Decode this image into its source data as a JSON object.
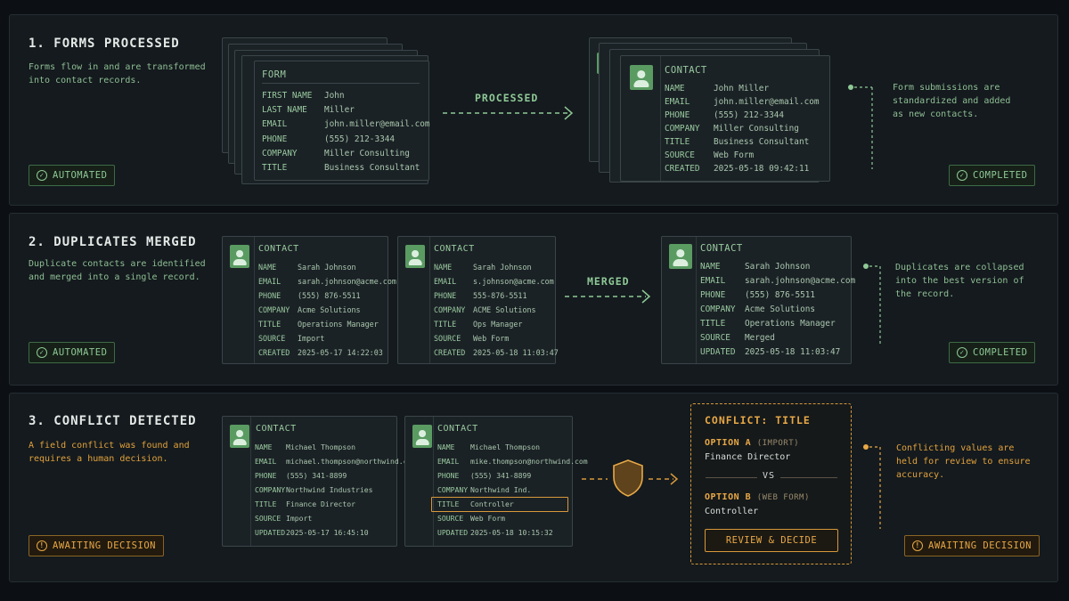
{
  "colors": {
    "background": "#0c1014",
    "panel": "#141a1e",
    "accent_green": "#8fc996",
    "accent_amber": "#e8a846"
  },
  "sections": [
    {
      "title": "1. FORMS PROCESSED",
      "description": "Forms flow in and are transformed into contact records.",
      "left_badge": {
        "label": "AUTOMATED",
        "icon": "check-circle-icon"
      },
      "right_badge": {
        "label": "COMPLETED",
        "icon": "check-circle-icon"
      },
      "arrow_label": "PROCESSED",
      "note": "Form submissions are standardized and added as new contacts.",
      "form": {
        "title": "FORM",
        "fields": [
          {
            "k": "FIRST NAME",
            "v": "John"
          },
          {
            "k": "LAST NAME",
            "v": "Miller"
          },
          {
            "k": "EMAIL",
            "v": "john.miller@email.com"
          },
          {
            "k": "PHONE",
            "v": "(555) 212-3344"
          },
          {
            "k": "COMPANY",
            "v": "Miller Consulting"
          },
          {
            "k": "TITLE",
            "v": "Business Consultant"
          }
        ]
      },
      "contact": {
        "title": "CONTACT",
        "fields": [
          {
            "k": "NAME",
            "v": "John Miller"
          },
          {
            "k": "EMAIL",
            "v": "john.miller@email.com"
          },
          {
            "k": "PHONE",
            "v": "(555) 212-3344"
          },
          {
            "k": "COMPANY",
            "v": "Miller Consulting"
          },
          {
            "k": "TITLE",
            "v": "Business Consultant"
          },
          {
            "k": "SOURCE",
            "v": "Web Form"
          },
          {
            "k": "CREATED",
            "v": "2025-05-18 09:42:11"
          }
        ]
      }
    },
    {
      "title": "2. DUPLICATES MERGED",
      "description": "Duplicate contacts are identified and merged into a single record.",
      "left_badge": {
        "label": "AUTOMATED",
        "icon": "check-circle-icon"
      },
      "right_badge": {
        "label": "COMPLETED",
        "icon": "check-circle-icon"
      },
      "arrow_label": "MERGED",
      "note": "Duplicates are collapsed into the best version of the record.",
      "contact_a": {
        "title": "CONTACT",
        "fields": [
          {
            "k": "NAME",
            "v": "Sarah Johnson"
          },
          {
            "k": "EMAIL",
            "v": "sarah.johnson@acme.com"
          },
          {
            "k": "PHONE",
            "v": "(555) 876-5511"
          },
          {
            "k": "COMPANY",
            "v": "Acme Solutions"
          },
          {
            "k": "TITLE",
            "v": "Operations Manager"
          },
          {
            "k": "SOURCE",
            "v": "Import"
          },
          {
            "k": "CREATED",
            "v": "2025-05-17 14:22:03"
          }
        ]
      },
      "contact_b": {
        "title": "CONTACT",
        "fields": [
          {
            "k": "NAME",
            "v": "Sarah Johnson"
          },
          {
            "k": "EMAIL",
            "v": "s.johnson@acme.com"
          },
          {
            "k": "PHONE",
            "v": "555-876-5511"
          },
          {
            "k": "COMPANY",
            "v": "ACME Solutions"
          },
          {
            "k": "TITLE",
            "v": "Ops Manager"
          },
          {
            "k": "SOURCE",
            "v": "Web Form"
          },
          {
            "k": "CREATED",
            "v": "2025-05-18 11:03:47"
          }
        ]
      },
      "contact_merged": {
        "title": "CONTACT",
        "fields": [
          {
            "k": "NAME",
            "v": "Sarah Johnson"
          },
          {
            "k": "EMAIL",
            "v": "sarah.johnson@acme.com"
          },
          {
            "k": "PHONE",
            "v": "(555) 876-5511"
          },
          {
            "k": "COMPANY",
            "v": "Acme Solutions"
          },
          {
            "k": "TITLE",
            "v": "Operations Manager"
          },
          {
            "k": "SOURCE",
            "v": "Merged"
          },
          {
            "k": "UPDATED",
            "v": "2025-05-18 11:03:47"
          }
        ]
      }
    },
    {
      "title": "3. CONFLICT DETECTED",
      "description": "A field conflict was found and requires a human decision.",
      "left_badge": {
        "label": "AWAITING DECISION",
        "icon": "alert-circle-icon"
      },
      "right_badge": {
        "label": "AWAITING DECISION",
        "icon": "alert-circle-icon"
      },
      "note": "Conflicting values are held for review to ensure accuracy.",
      "contact_a": {
        "title": "CONTACT",
        "fields": [
          {
            "k": "NAME",
            "v": "Michael Thompson"
          },
          {
            "k": "EMAIL",
            "v": "michael.thompson@northwind.com"
          },
          {
            "k": "PHONE",
            "v": "(555) 341-8899"
          },
          {
            "k": "COMPANY",
            "v": "Northwind Industries"
          },
          {
            "k": "TITLE",
            "v": "Finance Director"
          },
          {
            "k": "SOURCE",
            "v": "Import"
          },
          {
            "k": "UPDATED",
            "v": "2025-05-17 16:45:10"
          }
        ]
      },
      "contact_b": {
        "title": "CONTACT",
        "fields": [
          {
            "k": "NAME",
            "v": "Michael Thompson"
          },
          {
            "k": "EMAIL",
            "v": "mike.thompson@northwind.com"
          },
          {
            "k": "PHONE",
            "v": "(555) 341-8899"
          },
          {
            "k": "COMPANY",
            "v": "Northwind Ind."
          },
          {
            "k": "TITLE",
            "v": "Controller"
          },
          {
            "k": "SOURCE",
            "v": "Web Form"
          },
          {
            "k": "UPDATED",
            "v": "2025-05-18 10:15:32"
          }
        ]
      },
      "conflict": {
        "title": "CONFLICT: TITLE",
        "option_a_label": "OPTION A",
        "option_a_source": "(IMPORT)",
        "option_a_value": "Finance Director",
        "vs": "VS",
        "option_b_label": "OPTION B",
        "option_b_source": "(WEB FORM)",
        "option_b_value": "Controller",
        "button": "REVIEW & DECIDE"
      }
    }
  ]
}
